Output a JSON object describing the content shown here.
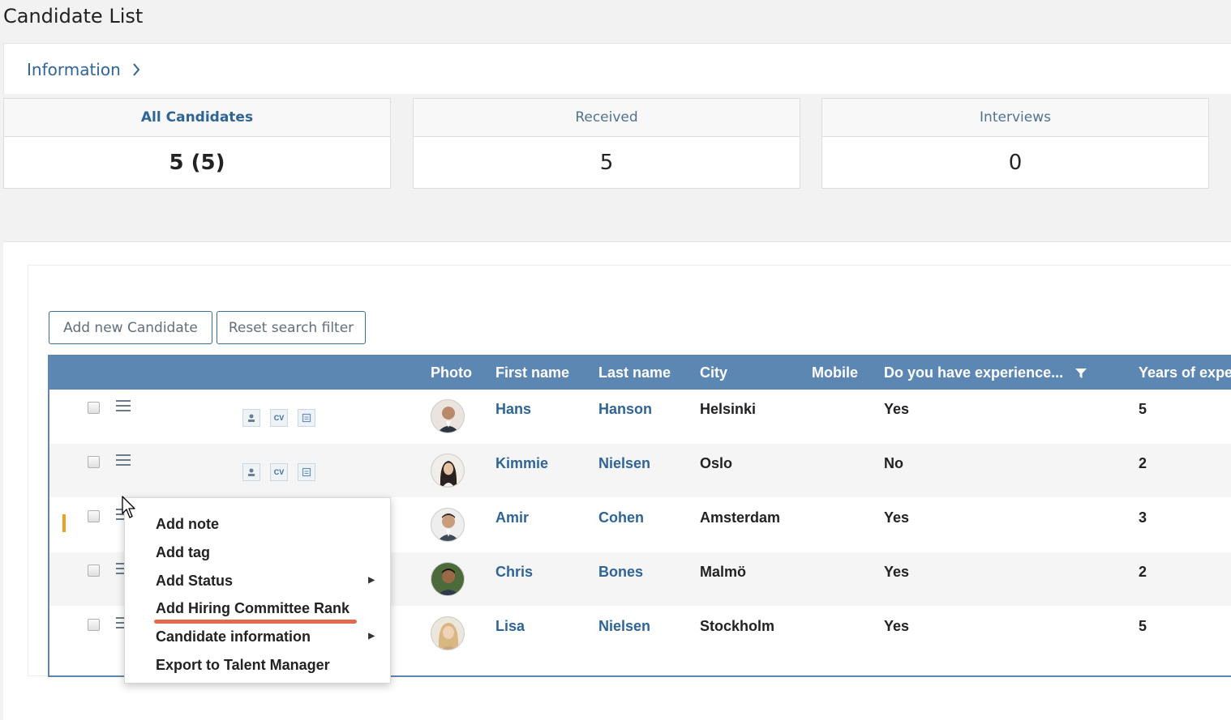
{
  "page": {
    "title": "Candidate List"
  },
  "info_bar": {
    "label": "Information",
    "chevron_icon": "chevron-right-icon"
  },
  "stats": [
    {
      "label": "All Candidates",
      "value": "5 (5)"
    },
    {
      "label": "Received",
      "value": "5"
    },
    {
      "label": "Interviews",
      "value": "0"
    }
  ],
  "toolbar": {
    "add_label": "Add new Candidate",
    "reset_label": "Reset search filter"
  },
  "table": {
    "headers": {
      "photo": "Photo",
      "first_name": "First name",
      "last_name": "Last name",
      "city": "City",
      "mobile": "Mobile",
      "experience": "Do you have experience...",
      "years": "Years of expe"
    },
    "filter_icon": "filter-icon",
    "doc_icons": [
      "profile-icon",
      "cv-icon",
      "document-icon"
    ],
    "cv_text": "CV",
    "rows": [
      {
        "first": "Hans",
        "last": "Hanson",
        "city": "Helsinki",
        "mobile": "",
        "experience": "Yes",
        "years": "5"
      },
      {
        "first": "Kimmie",
        "last": "Nielsen",
        "city": "Oslo",
        "mobile": "",
        "experience": "No",
        "years": "2"
      },
      {
        "first": "Amir",
        "last": "Cohen",
        "city": "Amsterdam",
        "mobile": "",
        "experience": "Yes",
        "years": "3"
      },
      {
        "first": "Chris",
        "last": "Bones",
        "city": "Malmö",
        "mobile": "",
        "experience": "Yes",
        "years": "2"
      },
      {
        "first": "Lisa",
        "last": "Nielsen",
        "city": "Stockholm",
        "mobile": "",
        "experience": "Yes",
        "years": "5"
      }
    ]
  },
  "context_menu": {
    "items": [
      {
        "label": "Add note",
        "submenu": false
      },
      {
        "label": "Add tag",
        "submenu": false
      },
      {
        "label": "Add Status",
        "submenu": true
      },
      {
        "label": "Add Hiring Committee Rank",
        "submenu": false
      },
      {
        "label": "Candidate information",
        "submenu": true
      },
      {
        "label": "Export to Talent Manager",
        "submenu": false
      }
    ],
    "highlight_color": "#e46a4f"
  },
  "colors": {
    "accent": "#2f6496",
    "header_bg": "#5d87b3",
    "marker": "#f0a020"
  }
}
